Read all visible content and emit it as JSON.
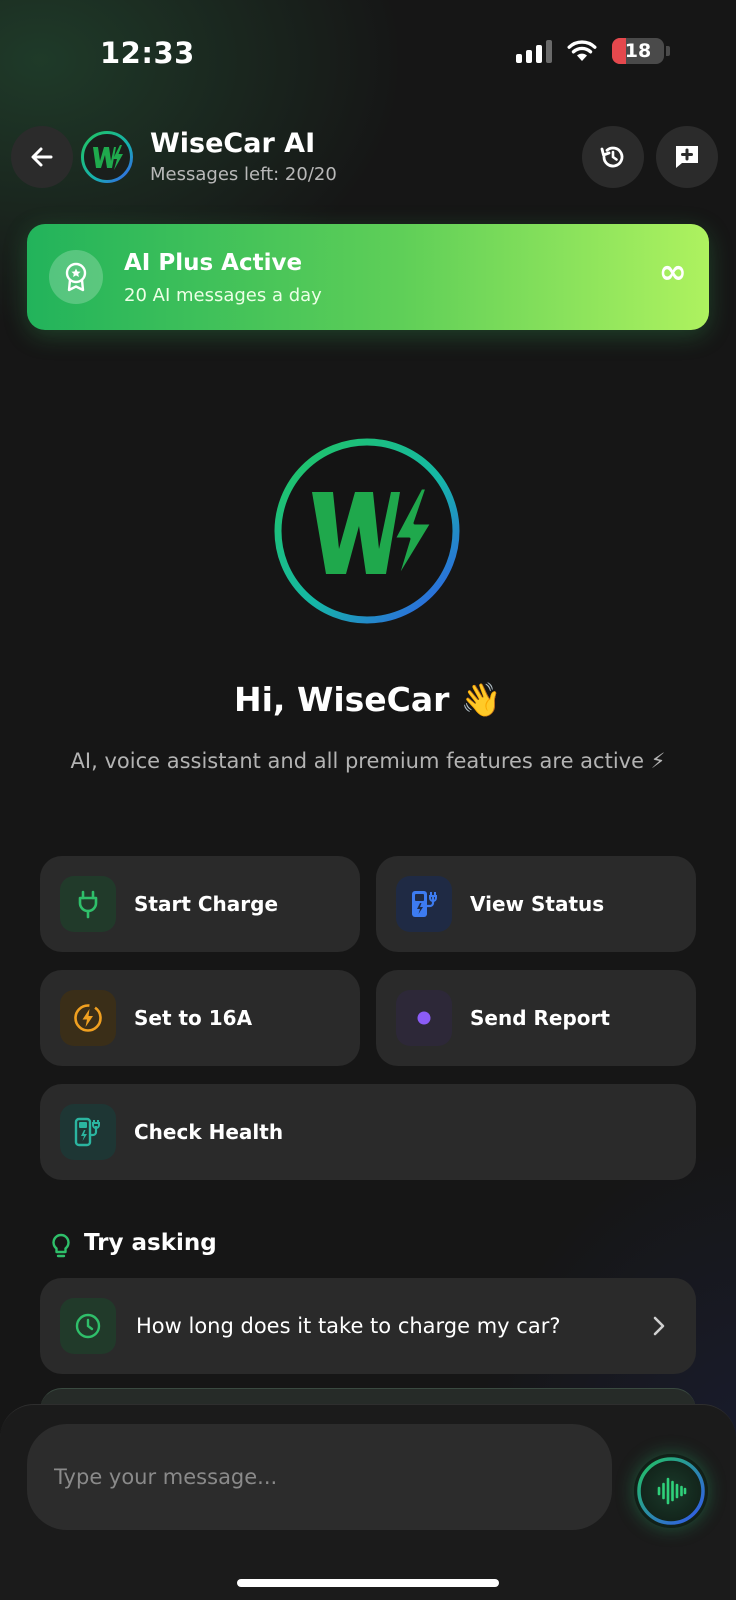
{
  "status_bar": {
    "time": "12:33",
    "battery": "18"
  },
  "header": {
    "title": "WiseCar AI",
    "subtitle": "Messages left: 20/20"
  },
  "banner": {
    "title": "AI Plus Active",
    "subtitle": "20 AI messages a day",
    "symbol": "∞"
  },
  "hero": {
    "greeting": "Hi, WiseCar 👋",
    "tagline": "AI, voice assistant and all premium features are active ⚡"
  },
  "actions": [
    {
      "label": "Start Charge",
      "icon": "plug-icon",
      "color": "#2fbf6a"
    },
    {
      "label": "View Status",
      "icon": "charger-status-icon",
      "color": "#3d7bf0"
    },
    {
      "label": "Set to 16A",
      "icon": "lightning-circle-icon",
      "color": "#f0a020"
    },
    {
      "label": "Send Report",
      "icon": "dot-icon",
      "color": "#8b5cf6"
    },
    {
      "label": "Check Health",
      "icon": "ev-charger-icon",
      "color": "#2bb5a0"
    }
  ],
  "try_asking": {
    "title": "Try asking",
    "suggestions": [
      {
        "text": "How long does it take to charge my car?",
        "icon": "clock-icon"
      }
    ]
  },
  "composer": {
    "placeholder": "Type your message..."
  },
  "colors": {
    "accent_green": "#22b35b",
    "accent_lime": "#aef25f",
    "background": "#161616"
  }
}
